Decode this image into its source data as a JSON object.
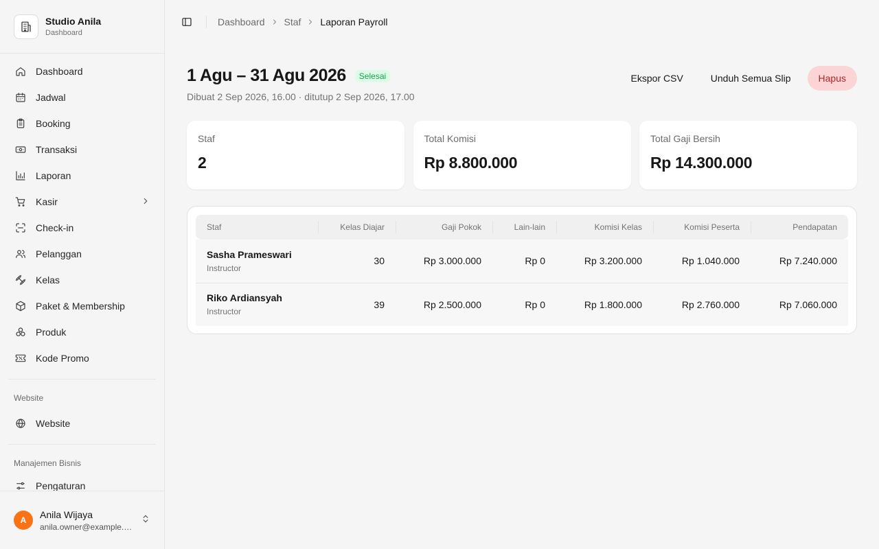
{
  "brand": {
    "name": "Studio Anila",
    "subtitle": "Dashboard"
  },
  "sidebar": {
    "items": [
      {
        "label": "Dashboard",
        "icon": "home-icon"
      },
      {
        "label": "Jadwal",
        "icon": "calendar-icon"
      },
      {
        "label": "Booking",
        "icon": "clipboard-icon"
      },
      {
        "label": "Transaksi",
        "icon": "banknote-icon"
      },
      {
        "label": "Laporan",
        "icon": "bar-chart-icon"
      },
      {
        "label": "Kasir",
        "icon": "cart-icon"
      },
      {
        "label": "Check-in",
        "icon": "scan-icon"
      },
      {
        "label": "Pelanggan",
        "icon": "users-icon"
      },
      {
        "label": "Kelas",
        "icon": "dumbbell-icon"
      },
      {
        "label": "Paket & Membership",
        "icon": "package-icon"
      },
      {
        "label": "Produk",
        "icon": "boxes-icon"
      },
      {
        "label": "Kode Promo",
        "icon": "ticket-icon"
      }
    ],
    "website_group": "Website",
    "website_item": "Website",
    "business_group": "Manajemen Bisnis",
    "settings_item": "Pengaturan"
  },
  "user": {
    "initial": "A",
    "name": "Anila Wijaya",
    "email": "anila.owner@example.com"
  },
  "breadcrumb": [
    "Dashboard",
    "Staf",
    "Laporan Payroll"
  ],
  "page": {
    "title": "1 Agu – 31 Agu 2026",
    "status": "Selesai",
    "subtitle": "Dibuat 2 Sep 2026, 16.00 · ditutup 2 Sep 2026, 17.00",
    "actions": {
      "export": "Ekspor CSV",
      "download": "Unduh Semua Slip",
      "delete": "Hapus"
    }
  },
  "stats": [
    {
      "label": "Staf",
      "value": "2"
    },
    {
      "label": "Total Komisi",
      "value": "Rp 8.800.000"
    },
    {
      "label": "Total Gaji Bersih",
      "value": "Rp 14.300.000"
    }
  ],
  "table": {
    "headers": [
      "Staf",
      "Kelas Diajar",
      "Gaji Pokok",
      "Lain-lain",
      "Komisi Kelas",
      "Komisi Peserta",
      "Pendapatan"
    ],
    "rows": [
      {
        "name": "Sasha Prameswari",
        "role": "Instructor",
        "classes": "30",
        "base": "Rp 3.000.000",
        "other": "Rp 0",
        "class_comm": "Rp 3.200.000",
        "participant_comm": "Rp 1.040.000",
        "income": "Rp 7.240.000"
      },
      {
        "name": "Riko Ardiansyah",
        "role": "Instructor",
        "classes": "39",
        "base": "Rp 2.500.000",
        "other": "Rp 0",
        "class_comm": "Rp 1.800.000",
        "participant_comm": "Rp 2.760.000",
        "income": "Rp 7.060.000"
      }
    ]
  },
  "colors": {
    "accent_avatar": "#f97316",
    "status_green": "#16a34a",
    "danger": "#b42323"
  }
}
